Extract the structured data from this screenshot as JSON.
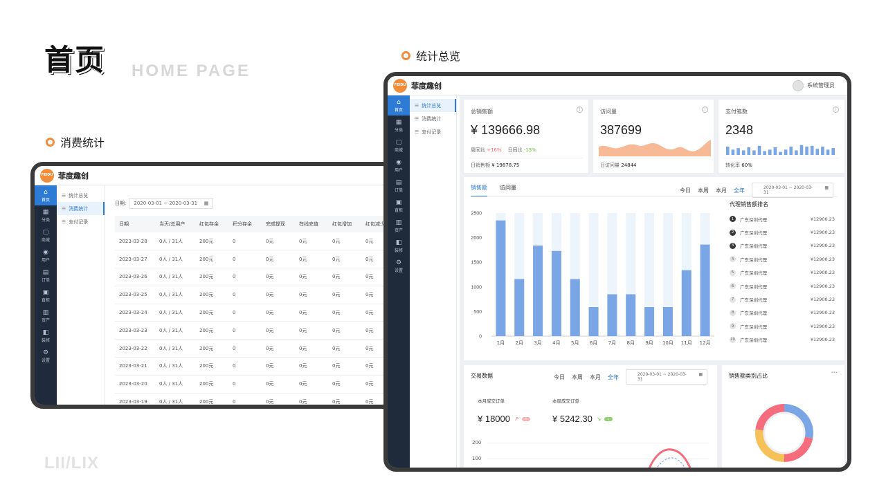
{
  "hero": {
    "title": "首页",
    "subtitle": "HOME PAGE",
    "footer_logo": "LII/LIX"
  },
  "sections": {
    "consume": "消费统计",
    "overview": "统计总览"
  },
  "app": {
    "brand": "菲度趣创",
    "logo_text": "FEIDU",
    "user": "系统管理员"
  },
  "nav": [
    {
      "icon": "⌂",
      "label": "首页"
    },
    {
      "icon": "▦",
      "label": "分类"
    },
    {
      "icon": "▢",
      "label": "商城"
    },
    {
      "icon": "◉",
      "label": "用户"
    },
    {
      "icon": "▤",
      "label": "订单"
    },
    {
      "icon": "▣",
      "label": "直柜"
    },
    {
      "icon": "▥",
      "label": "资产"
    },
    {
      "icon": "◧",
      "label": "装修"
    },
    {
      "icon": "⚙",
      "label": "设置"
    }
  ],
  "subnav": [
    "统计总览",
    "消费统计",
    "支付记录"
  ],
  "consume_page": {
    "date_label": "日期:",
    "date_range": "2020-03-01 ~ 2020-03-31",
    "columns": [
      "日期",
      "当天/总用户",
      "红包存余",
      "积分存余",
      "完成提现",
      "在线充值",
      "红包增加",
      "红包减少"
    ],
    "rows": [
      [
        "2023-03-28",
        "0人 / 31人",
        "200元",
        "0",
        "0元",
        "0元",
        "0元",
        "0元"
      ],
      [
        "2023-03-27",
        "0人 / 31人",
        "200元",
        "0",
        "0元",
        "0元",
        "0元",
        "0元"
      ],
      [
        "2023-03-26",
        "0人 / 31人",
        "200元",
        "0",
        "0元",
        "0元",
        "0元",
        "0元"
      ],
      [
        "2023-03-25",
        "0人 / 31人",
        "200元",
        "0",
        "0元",
        "0元",
        "0元",
        "0元"
      ],
      [
        "2023-03-24",
        "0人 / 31人",
        "200元",
        "0",
        "0元",
        "0元",
        "0元",
        "0元"
      ],
      [
        "2023-03-23",
        "0人 / 31人",
        "200元",
        "0",
        "0元",
        "0元",
        "0元",
        "0元"
      ],
      [
        "2023-03-22",
        "0人 / 31人",
        "200元",
        "0",
        "0元",
        "0元",
        "0元",
        "0元"
      ],
      [
        "2023-03-21",
        "0人 / 31人",
        "200元",
        "0",
        "0元",
        "0元",
        "0元",
        "0元"
      ],
      [
        "2023-03-20",
        "0人 / 31人",
        "200元",
        "0",
        "0元",
        "0元",
        "0元",
        "0元"
      ],
      [
        "2023-03-19",
        "0人 / 31人",
        "200元",
        "0",
        "0元",
        "0元",
        "0元",
        "0元"
      ]
    ]
  },
  "overview": {
    "sales": {
      "title": "总销售额",
      "value": "¥ 139666.98",
      "wow_label": "周同比",
      "wow": "+16%",
      "dod_label": "日同比",
      "dod": "-13%",
      "daily_label": "日销售额",
      "daily": "¥ 19878.75"
    },
    "visits": {
      "title": "访问量",
      "value": "387699",
      "daily_label": "日访问量",
      "daily": "24844"
    },
    "payments": {
      "title": "支付笔数",
      "value": "2348",
      "rate_label": "转化率",
      "rate": "60%"
    },
    "tabs": [
      "销售额",
      "访问量"
    ],
    "ranges": [
      "今日",
      "本周",
      "本月",
      "全年"
    ],
    "date_range": "2020-03-01 ~ 2020-03-31",
    "ranking_title": "代理销售额排名",
    "ranking": [
      {
        "no": "1",
        "name": "广东深圳代理",
        "amount": "¥12900.23"
      },
      {
        "no": "2",
        "name": "广东深圳代理",
        "amount": "¥12900.23"
      },
      {
        "no": "3",
        "name": "广东深圳代理",
        "amount": "¥12900.23"
      },
      {
        "no": "4",
        "name": "广东深圳代理",
        "amount": "¥12900.23"
      },
      {
        "no": "5",
        "name": "广东深圳代理",
        "amount": "¥12900.23"
      },
      {
        "no": "6",
        "name": "广东深圳代理",
        "amount": "¥12900.23"
      },
      {
        "no": "7",
        "name": "广东深圳代理",
        "amount": "¥12900.23"
      },
      {
        "no": "8",
        "name": "广东深圳代理",
        "amount": "¥12900.23"
      },
      {
        "no": "9",
        "name": "广东深圳代理",
        "amount": "¥12900.23"
      },
      {
        "no": "10",
        "name": "广东深圳代理",
        "amount": "¥12900.23"
      }
    ],
    "trade": {
      "title": "交易数据",
      "month_label": "本月成交订单",
      "month_value": "¥ 18000",
      "month_badge": "↑",
      "week_label": "本周成交订单",
      "week_value": "¥ 5242.30",
      "week_badge": "↓",
      "y_ticks": [
        "200",
        "100"
      ]
    },
    "category_title": "销售额类别占比",
    "more": "···"
  },
  "chart_data": [
    {
      "type": "bar",
      "categories": [
        "1月",
        "2月",
        "3月",
        "4月",
        "5月",
        "6月",
        "7月",
        "8月",
        "9月",
        "10月",
        "11月",
        "12月"
      ],
      "values": [
        2350,
        1160,
        1840,
        1730,
        1160,
        590,
        850,
        850,
        590,
        590,
        1340,
        1860
      ],
      "ylim": [
        0,
        2500
      ],
      "yticks": [
        0,
        500,
        1000,
        1500,
        2000,
        2500
      ],
      "colors": {
        "bar": "#7aa6e6",
        "track": "#eef4fc"
      }
    },
    {
      "type": "bar",
      "values": [
        0.55,
        0.35,
        0.45,
        0.3,
        0.5,
        0.3,
        0.6,
        0.25,
        0.35,
        0.5,
        0.2,
        0.35,
        0.55,
        0.3,
        0.65,
        0.55,
        0.6,
        0.4,
        0.55,
        0.35,
        0.45
      ],
      "colors": {
        "bar": "#7aa6e6"
      }
    },
    {
      "type": "pie",
      "values": [
        28,
        22,
        27,
        23
      ],
      "colors": [
        "#7aa6e6",
        "#f56d7c",
        "#f7c15a",
        "#f56d7c"
      ]
    }
  ]
}
